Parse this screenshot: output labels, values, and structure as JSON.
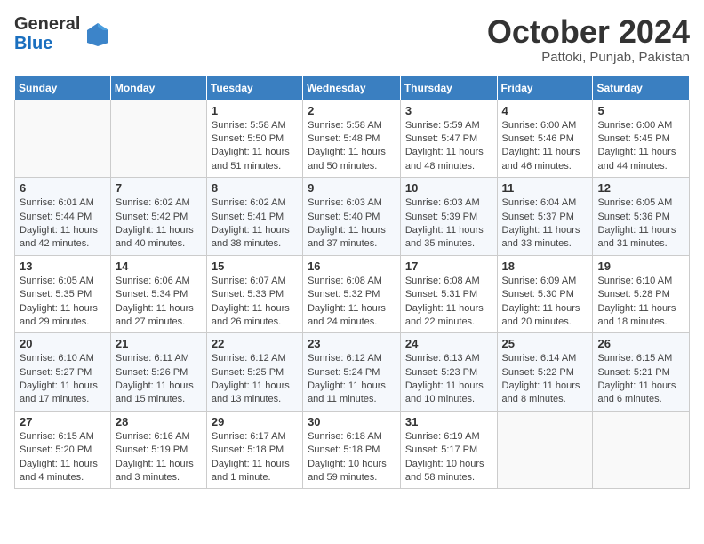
{
  "header": {
    "logo_general": "General",
    "logo_blue": "Blue",
    "month_title": "October 2024",
    "subtitle": "Pattoki, Punjab, Pakistan"
  },
  "days_of_week": [
    "Sunday",
    "Monday",
    "Tuesday",
    "Wednesday",
    "Thursday",
    "Friday",
    "Saturday"
  ],
  "weeks": [
    [
      {
        "day": "",
        "sunrise": "",
        "sunset": "",
        "daylight": ""
      },
      {
        "day": "",
        "sunrise": "",
        "sunset": "",
        "daylight": ""
      },
      {
        "day": "1",
        "sunrise": "Sunrise: 5:58 AM",
        "sunset": "Sunset: 5:50 PM",
        "daylight": "Daylight: 11 hours and 51 minutes."
      },
      {
        "day": "2",
        "sunrise": "Sunrise: 5:58 AM",
        "sunset": "Sunset: 5:48 PM",
        "daylight": "Daylight: 11 hours and 50 minutes."
      },
      {
        "day": "3",
        "sunrise": "Sunrise: 5:59 AM",
        "sunset": "Sunset: 5:47 PM",
        "daylight": "Daylight: 11 hours and 48 minutes."
      },
      {
        "day": "4",
        "sunrise": "Sunrise: 6:00 AM",
        "sunset": "Sunset: 5:46 PM",
        "daylight": "Daylight: 11 hours and 46 minutes."
      },
      {
        "day": "5",
        "sunrise": "Sunrise: 6:00 AM",
        "sunset": "Sunset: 5:45 PM",
        "daylight": "Daylight: 11 hours and 44 minutes."
      }
    ],
    [
      {
        "day": "6",
        "sunrise": "Sunrise: 6:01 AM",
        "sunset": "Sunset: 5:44 PM",
        "daylight": "Daylight: 11 hours and 42 minutes."
      },
      {
        "day": "7",
        "sunrise": "Sunrise: 6:02 AM",
        "sunset": "Sunset: 5:42 PM",
        "daylight": "Daylight: 11 hours and 40 minutes."
      },
      {
        "day": "8",
        "sunrise": "Sunrise: 6:02 AM",
        "sunset": "Sunset: 5:41 PM",
        "daylight": "Daylight: 11 hours and 38 minutes."
      },
      {
        "day": "9",
        "sunrise": "Sunrise: 6:03 AM",
        "sunset": "Sunset: 5:40 PM",
        "daylight": "Daylight: 11 hours and 37 minutes."
      },
      {
        "day": "10",
        "sunrise": "Sunrise: 6:03 AM",
        "sunset": "Sunset: 5:39 PM",
        "daylight": "Daylight: 11 hours and 35 minutes."
      },
      {
        "day": "11",
        "sunrise": "Sunrise: 6:04 AM",
        "sunset": "Sunset: 5:37 PM",
        "daylight": "Daylight: 11 hours and 33 minutes."
      },
      {
        "day": "12",
        "sunrise": "Sunrise: 6:05 AM",
        "sunset": "Sunset: 5:36 PM",
        "daylight": "Daylight: 11 hours and 31 minutes."
      }
    ],
    [
      {
        "day": "13",
        "sunrise": "Sunrise: 6:05 AM",
        "sunset": "Sunset: 5:35 PM",
        "daylight": "Daylight: 11 hours and 29 minutes."
      },
      {
        "day": "14",
        "sunrise": "Sunrise: 6:06 AM",
        "sunset": "Sunset: 5:34 PM",
        "daylight": "Daylight: 11 hours and 27 minutes."
      },
      {
        "day": "15",
        "sunrise": "Sunrise: 6:07 AM",
        "sunset": "Sunset: 5:33 PM",
        "daylight": "Daylight: 11 hours and 26 minutes."
      },
      {
        "day": "16",
        "sunrise": "Sunrise: 6:08 AM",
        "sunset": "Sunset: 5:32 PM",
        "daylight": "Daylight: 11 hours and 24 minutes."
      },
      {
        "day": "17",
        "sunrise": "Sunrise: 6:08 AM",
        "sunset": "Sunset: 5:31 PM",
        "daylight": "Daylight: 11 hours and 22 minutes."
      },
      {
        "day": "18",
        "sunrise": "Sunrise: 6:09 AM",
        "sunset": "Sunset: 5:30 PM",
        "daylight": "Daylight: 11 hours and 20 minutes."
      },
      {
        "day": "19",
        "sunrise": "Sunrise: 6:10 AM",
        "sunset": "Sunset: 5:28 PM",
        "daylight": "Daylight: 11 hours and 18 minutes."
      }
    ],
    [
      {
        "day": "20",
        "sunrise": "Sunrise: 6:10 AM",
        "sunset": "Sunset: 5:27 PM",
        "daylight": "Daylight: 11 hours and 17 minutes."
      },
      {
        "day": "21",
        "sunrise": "Sunrise: 6:11 AM",
        "sunset": "Sunset: 5:26 PM",
        "daylight": "Daylight: 11 hours and 15 minutes."
      },
      {
        "day": "22",
        "sunrise": "Sunrise: 6:12 AM",
        "sunset": "Sunset: 5:25 PM",
        "daylight": "Daylight: 11 hours and 13 minutes."
      },
      {
        "day": "23",
        "sunrise": "Sunrise: 6:12 AM",
        "sunset": "Sunset: 5:24 PM",
        "daylight": "Daylight: 11 hours and 11 minutes."
      },
      {
        "day": "24",
        "sunrise": "Sunrise: 6:13 AM",
        "sunset": "Sunset: 5:23 PM",
        "daylight": "Daylight: 11 hours and 10 minutes."
      },
      {
        "day": "25",
        "sunrise": "Sunrise: 6:14 AM",
        "sunset": "Sunset: 5:22 PM",
        "daylight": "Daylight: 11 hours and 8 minutes."
      },
      {
        "day": "26",
        "sunrise": "Sunrise: 6:15 AM",
        "sunset": "Sunset: 5:21 PM",
        "daylight": "Daylight: 11 hours and 6 minutes."
      }
    ],
    [
      {
        "day": "27",
        "sunrise": "Sunrise: 6:15 AM",
        "sunset": "Sunset: 5:20 PM",
        "daylight": "Daylight: 11 hours and 4 minutes."
      },
      {
        "day": "28",
        "sunrise": "Sunrise: 6:16 AM",
        "sunset": "Sunset: 5:19 PM",
        "daylight": "Daylight: 11 hours and 3 minutes."
      },
      {
        "day": "29",
        "sunrise": "Sunrise: 6:17 AM",
        "sunset": "Sunset: 5:18 PM",
        "daylight": "Daylight: 11 hours and 1 minute."
      },
      {
        "day": "30",
        "sunrise": "Sunrise: 6:18 AM",
        "sunset": "Sunset: 5:18 PM",
        "daylight": "Daylight: 10 hours and 59 minutes."
      },
      {
        "day": "31",
        "sunrise": "Sunrise: 6:19 AM",
        "sunset": "Sunset: 5:17 PM",
        "daylight": "Daylight: 10 hours and 58 minutes."
      },
      {
        "day": "",
        "sunrise": "",
        "sunset": "",
        "daylight": ""
      },
      {
        "day": "",
        "sunrise": "",
        "sunset": "",
        "daylight": ""
      }
    ]
  ]
}
